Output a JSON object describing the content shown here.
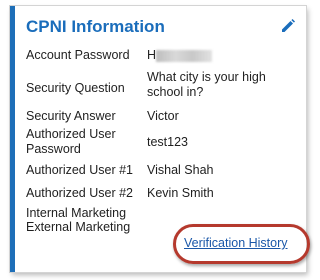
{
  "card": {
    "title": "CPNI Information",
    "edit_icon": "pencil-icon",
    "accent_color": "#1e6fb8",
    "fields": [
      {
        "label": "Account Password",
        "value": "H"
      },
      {
        "label": "Security Question",
        "value": "What city is your high school in?"
      },
      {
        "label": "Security Answer",
        "value": "Victor"
      },
      {
        "label": "Authorized User Password",
        "value": "test123"
      },
      {
        "label": "Authorized User #1",
        "value": "Vishal Shah"
      },
      {
        "label": "Authorized User #2",
        "value": "Kevin Smith"
      },
      {
        "label": "Internal Marketing",
        "value": ""
      },
      {
        "label": "External Marketing",
        "value": ""
      }
    ],
    "history_link": "Verification History",
    "highlight_color": "#b5392d"
  }
}
